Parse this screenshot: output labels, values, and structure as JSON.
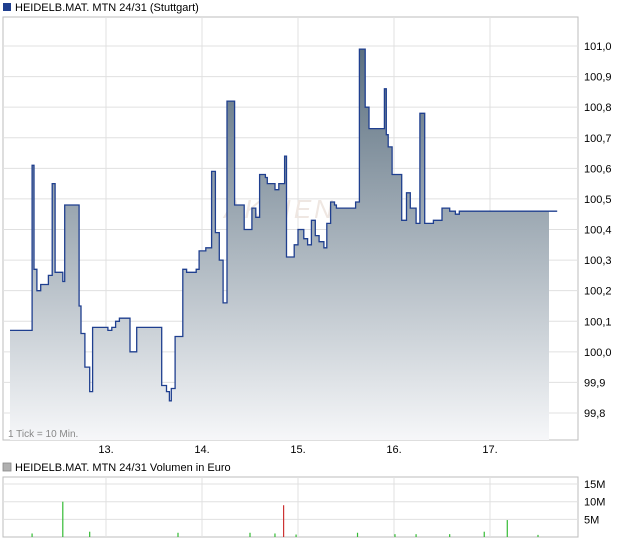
{
  "chart_data": [
    {
      "type": "area",
      "title": "HEIDELB.MAT. MTN 24/31 (Stuttgart)",
      "note": "1 Tick = 10 Min.",
      "watermark": "AKTIEN",
      "x_ticks": [
        "13.",
        "14.",
        "15.",
        "16.",
        "17."
      ],
      "x_tick_days": [
        1,
        2,
        3,
        4,
        5
      ],
      "x_range_days": [
        0,
        5.7
      ],
      "y_ticks": [
        "99,8",
        "99,9",
        "100,0",
        "100,1",
        "100,2",
        "100,3",
        "100,4",
        "100,5",
        "100,6",
        "100,7",
        "100,8",
        "100,9",
        "101,0"
      ],
      "ylim": [
        99.7,
        101.08
      ],
      "grid": true,
      "legend": "top-left",
      "colors": {
        "line": "#1f3f8f",
        "fill_top": "#5c7080",
        "fill_bottom": "#f6f7f9",
        "grid": "#e0e0e0",
        "legend_swatch": "#1f3f8f"
      },
      "series": [
        {
          "name": "HEIDELB.MAT. MTN 24/31 (Stuttgart)",
          "x": [
            0.0,
            0.19,
            0.21,
            0.23,
            0.25,
            0.28,
            0.32,
            0.4,
            0.44,
            0.47,
            0.53,
            0.55,
            0.57,
            0.59,
            0.62,
            0.7,
            0.72,
            0.74,
            0.78,
            0.83,
            0.86,
            0.98,
            1.02,
            1.06,
            1.1,
            1.14,
            1.2,
            1.25,
            1.32,
            1.38,
            1.42,
            1.46,
            1.52,
            1.58,
            1.63,
            1.66,
            1.68,
            1.72,
            1.8,
            1.84,
            1.88,
            1.92,
            1.94,
            1.97,
            2.0,
            2.02,
            2.04,
            2.1,
            2.14,
            2.18,
            2.22,
            2.26,
            2.34,
            2.36,
            2.44,
            2.52,
            2.56,
            2.6,
            2.66,
            2.68,
            2.72,
            2.76,
            2.8,
            2.84,
            2.86,
            2.88,
            2.9,
            2.93,
            2.96,
            3.0,
            3.06,
            3.1,
            3.14,
            3.18,
            3.22,
            3.27,
            3.3,
            3.34,
            3.38,
            3.4,
            3.44,
            3.5,
            3.56,
            3.6,
            3.64,
            3.66,
            3.7,
            3.74,
            3.78,
            3.82,
            3.86,
            3.9,
            3.92,
            3.94,
            3.98,
            4.04,
            4.08,
            4.13,
            4.17,
            4.23,
            4.27,
            4.32,
            4.39,
            4.41,
            4.47,
            4.5,
            4.52,
            4.56,
            4.58,
            4.6,
            4.64,
            4.68,
            4.72,
            4.78,
            4.82,
            4.84,
            4.86,
            4.88,
            4.9,
            4.92,
            4.95,
            4.98,
            5.02,
            5.04,
            5.06,
            5.08,
            5.12,
            5.16,
            5.2,
            5.26,
            5.3,
            5.36,
            5.42,
            5.5,
            5.56,
            5.62,
            5.66,
            5.7
          ],
          "values": [
            100.07,
            100.07,
            100.07,
            100.61,
            100.27,
            100.2,
            100.22,
            100.25,
            100.55,
            100.26,
            100.26,
            100.23,
            100.48,
            100.48,
            100.48,
            100.48,
            100.15,
            100.06,
            99.95,
            99.87,
            100.08,
            100.08,
            100.07,
            100.08,
            100.1,
            100.11,
            100.11,
            100.0,
            100.08,
            100.08,
            100.08,
            100.08,
            100.08,
            99.89,
            99.87,
            99.84,
            99.88,
            100.05,
            100.27,
            100.26,
            100.26,
            100.26,
            100.27,
            100.33,
            100.33,
            100.33,
            100.34,
            100.59,
            100.39,
            100.3,
            100.16,
            100.82,
            100.48,
            100.48,
            100.4,
            100.47,
            100.44,
            100.58,
            100.57,
            100.55,
            100.55,
            100.53,
            100.55,
            100.55,
            100.64,
            100.31,
            100.31,
            100.31,
            100.35,
            100.4,
            100.37,
            100.35,
            100.43,
            100.38,
            100.36,
            100.34,
            100.42,
            100.49,
            100.48,
            100.47,
            100.47,
            100.47,
            100.47,
            100.49,
            100.99,
            100.99,
            100.8,
            100.73,
            100.73,
            100.73,
            100.73,
            100.86,
            100.71,
            100.67,
            100.58,
            100.58,
            100.43,
            100.52,
            100.47,
            100.42,
            100.78,
            100.42,
            100.42,
            100.43,
            100.43,
            100.47,
            100.47,
            100.47,
            100.46,
            100.46,
            100.45,
            100.46,
            100.46,
            100.46,
            100.46,
            100.46,
            100.46,
            100.46,
            100.46,
            100.46,
            100.46,
            100.46,
            100.46,
            100.46,
            100.46,
            100.46,
            100.46,
            100.46,
            100.46,
            100.46,
            100.46,
            100.46,
            100.46,
            100.46,
            100.46,
            100.46,
            100.46,
            100.46
          ]
        }
      ]
    },
    {
      "type": "bar",
      "title": "HEIDELB.MAT. MTN 24/31 Volumen in Euro",
      "y_ticks": [
        "5M",
        "10M",
        "15M"
      ],
      "y_tick_values": [
        5,
        10,
        15
      ],
      "ylim": [
        0,
        17
      ],
      "units": "M",
      "grid": true,
      "legend": "top-left",
      "colors": {
        "bar": "#33bb33",
        "bar_highlight": "#cc3333",
        "legend_swatch": "#b0b0b0",
        "grid": "#e0e0e0"
      },
      "x": [
        0.23,
        0.55,
        0.83,
        1.75,
        2.5,
        2.76,
        2.85,
        2.98,
        3.62,
        4.01,
        4.23,
        4.58,
        4.94,
        5.18,
        5.5
      ],
      "values": [
        1.0,
        10.0,
        1.5,
        1.2,
        1.2,
        1.0,
        9.0,
        0.7,
        1.2,
        0.8,
        0.8,
        0.8,
        1.5,
        4.8,
        0.6
      ],
      "highlight": [
        false,
        false,
        false,
        false,
        false,
        false,
        true,
        false,
        false,
        false,
        false,
        false,
        false,
        false,
        false
      ]
    }
  ]
}
